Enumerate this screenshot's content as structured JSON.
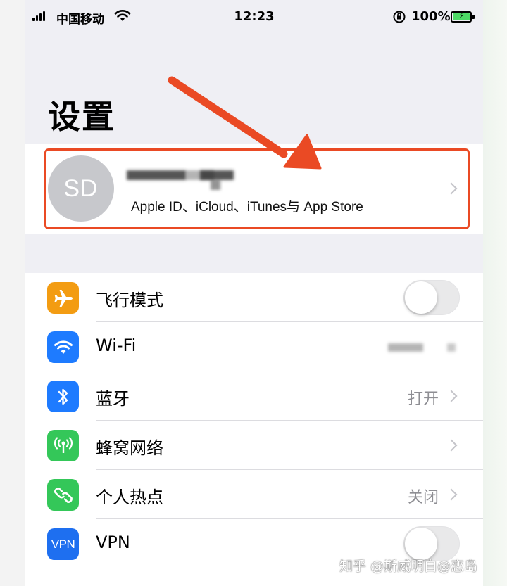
{
  "status_bar": {
    "carrier": "中国移动",
    "time": "12:23",
    "battery_percent": "100%"
  },
  "page_title": "设置",
  "profile": {
    "avatar_initials": "SD",
    "subtitle": "Apple ID、iCloud、iTunes与 App Store"
  },
  "settings": {
    "items": [
      {
        "label": "飞行模式",
        "icon": "airplane-icon",
        "icon_color": "#f39c12",
        "control": "toggle",
        "on": false
      },
      {
        "label": "Wi-Fi",
        "icon": "wifi-icon",
        "icon_color": "#1e7bff",
        "control": "value"
      },
      {
        "label": "蓝牙",
        "icon": "bluetooth-icon",
        "icon_color": "#1e7bff",
        "control": "value",
        "value": "打开"
      },
      {
        "label": "蜂窝网络",
        "icon": "antenna-icon",
        "icon_color": "#34c759",
        "control": "chevron"
      },
      {
        "label": "个人热点",
        "icon": "hotspot-icon",
        "icon_color": "#34c759",
        "control": "value",
        "value": "关闭"
      },
      {
        "label": "VPN",
        "icon": "vpn-icon",
        "icon_color": "#1e6ff0",
        "icon_text": "VPN",
        "control": "toggle",
        "on": false
      }
    ]
  },
  "annotation": {
    "color": "#ea4a24"
  },
  "watermark": "知乎 @斯威明白@恋岛"
}
